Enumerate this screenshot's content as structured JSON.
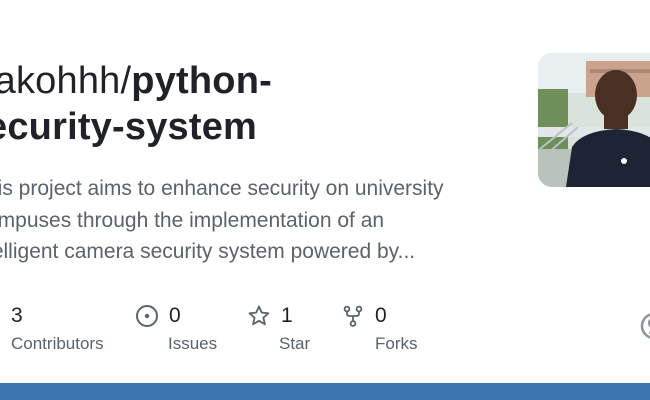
{
  "repo": {
    "owner": "Mjakohhh/",
    "name_line1": "python-",
    "name_line2": "security-system",
    "owner_visible": "lakohhh/",
    "name_line2_visible": "ecurity-system"
  },
  "description": {
    "line1": "his project aims to enhance security on university",
    "line2": "ampuses through the implementation of an",
    "line3": "telligent camera security system powered by..."
  },
  "stats": {
    "contributors": {
      "value": "3",
      "label": "Contributors",
      "icon": "people-icon"
    },
    "issues": {
      "value": "0",
      "label": "Issues",
      "icon": "issue-circle-icon"
    },
    "stars": {
      "value": "1",
      "label": "Star",
      "icon": "star-icon"
    },
    "forks": {
      "value": "0",
      "label": "Forks",
      "icon": "fork-icon"
    }
  },
  "colors": {
    "text_primary": "#1f2328",
    "text_muted": "#59636e",
    "footer_bar": "#3d76ad"
  },
  "icons": {
    "avatar": "owner-avatar-photo",
    "brand": "github-mark-icon"
  }
}
